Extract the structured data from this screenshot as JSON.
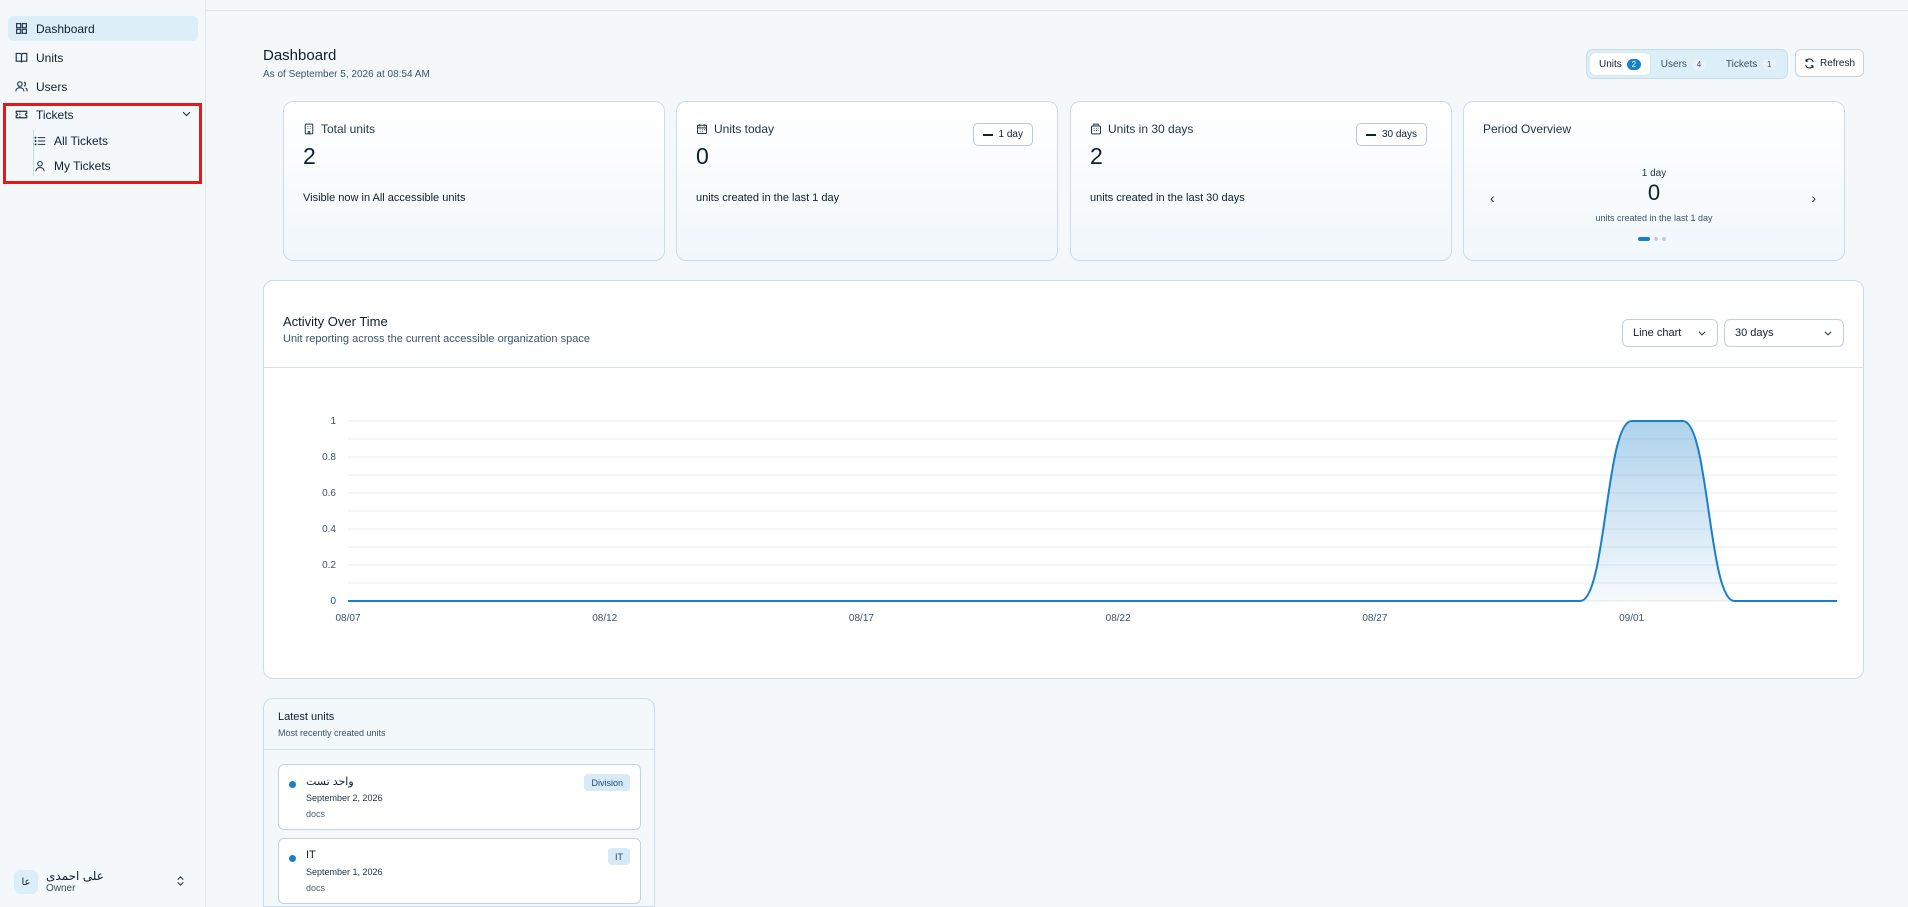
{
  "sidebar": {
    "items": [
      {
        "label": "Dashboard",
        "icon": "dashboard-icon",
        "active": true
      },
      {
        "label": "Units",
        "icon": "book-icon"
      },
      {
        "label": "Users",
        "icon": "users-icon"
      },
      {
        "label": "Tickets",
        "icon": "ticket-icon"
      }
    ],
    "tickets_sub": [
      {
        "label": "All Tickets",
        "icon": "list-icon"
      },
      {
        "label": "My Tickets",
        "icon": "user-icon"
      }
    ],
    "user": {
      "initials": "عا",
      "name": "علی احمدی",
      "role": "Owner"
    }
  },
  "header": {
    "title": "Dashboard",
    "subtitle": "As of September 5, 2026 at 08:54 AM",
    "tabs": [
      {
        "label": "Units",
        "count": "2",
        "active": true
      },
      {
        "label": "Users",
        "count": "4"
      },
      {
        "label": "Tickets",
        "count": "1"
      }
    ],
    "refresh_label": "Refresh"
  },
  "cards": {
    "total": {
      "title": "Total units",
      "value": "2",
      "desc": "Visible now in All accessible units"
    },
    "today": {
      "title": "Units today",
      "value": "0",
      "desc": "units created in the last 1 day",
      "pill": "1 day"
    },
    "thirty": {
      "title": "Units in 30 days",
      "value": "2",
      "desc": "units created in the last 30 days",
      "pill": "30 days"
    },
    "period": {
      "title": "Period Overview",
      "period_label": "1 day",
      "value": "0",
      "desc": "units created in the last 1 day",
      "prev": "‹",
      "next": "›"
    }
  },
  "activity": {
    "title": "Activity Over Time",
    "subtitle": "Unit reporting across the current accessible organization space",
    "chart_type_select": "Line chart",
    "range_select": "30 days"
  },
  "chart_data": {
    "type": "area",
    "title": "Activity Over Time",
    "x_ticks": [
      "08/07",
      "08/12",
      "08/17",
      "08/22",
      "08/27",
      "09/01"
    ],
    "y_ticks": [
      "0",
      "0.2",
      "0.4",
      "0.6",
      "0.8",
      "1"
    ],
    "ylim": [
      0,
      1
    ],
    "x": [
      "08/07",
      "08/08",
      "08/09",
      "08/10",
      "08/11",
      "08/12",
      "08/13",
      "08/14",
      "08/15",
      "08/16",
      "08/17",
      "08/18",
      "08/19",
      "08/20",
      "08/21",
      "08/22",
      "08/23",
      "08/24",
      "08/25",
      "08/26",
      "08/27",
      "08/28",
      "08/29",
      "08/30",
      "08/31",
      "09/01",
      "09/02",
      "09/03",
      "09/04",
      "09/05"
    ],
    "values": [
      0,
      0,
      0,
      0,
      0,
      0,
      0,
      0,
      0,
      0,
      0,
      0,
      0,
      0,
      0,
      0,
      0,
      0,
      0,
      0,
      0,
      0,
      0,
      0,
      0,
      1,
      1,
      0,
      0,
      0
    ],
    "color": "#1a7fc9",
    "grid": true
  },
  "latest": {
    "title": "Latest units",
    "subtitle": "Most recently created units",
    "items": [
      {
        "name": "واحد تست",
        "date": "September 2, 2026",
        "path": "docs",
        "badge": "Division"
      },
      {
        "name": "IT",
        "date": "September 1, 2026",
        "path": "docs",
        "badge": "IT"
      }
    ]
  }
}
